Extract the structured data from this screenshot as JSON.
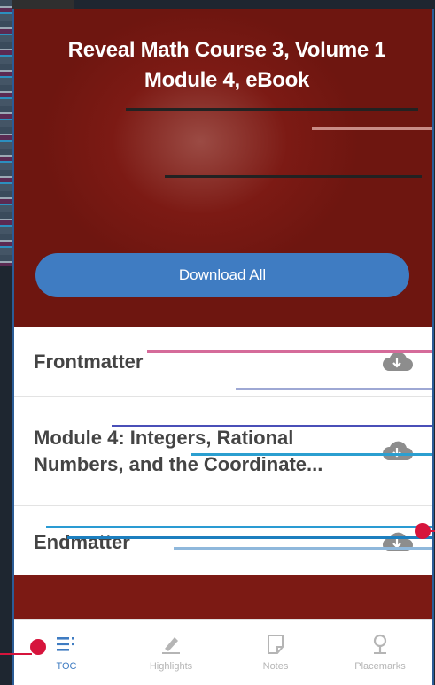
{
  "header": {
    "title_line1": "Reveal Math Course 3, Volume 1",
    "title_line2": "Module 4, eBook"
  },
  "download_all_label": "Download All",
  "toc_items": [
    {
      "label": "Frontmatter",
      "icon": "cloud-download-icon"
    },
    {
      "label": "Module 4: Integers, Rational Numbers, and the Coordinate...",
      "icon": "cloud-download-icon"
    },
    {
      "label": "Endmatter",
      "icon": "cloud-download-icon"
    }
  ],
  "tabs": [
    {
      "label": "TOC",
      "icon": "list-icon",
      "active": true
    },
    {
      "label": "Highlights",
      "icon": "highlighter-icon",
      "active": false
    },
    {
      "label": "Notes",
      "icon": "note-icon",
      "active": false
    },
    {
      "label": "Placemarks",
      "icon": "placemark-icon",
      "active": false
    }
  ],
  "colors": {
    "hero_bg": "#7c1a14",
    "accent": "#3f7cc2",
    "inactive": "#b5b5b5",
    "marker": "#d6143c"
  }
}
